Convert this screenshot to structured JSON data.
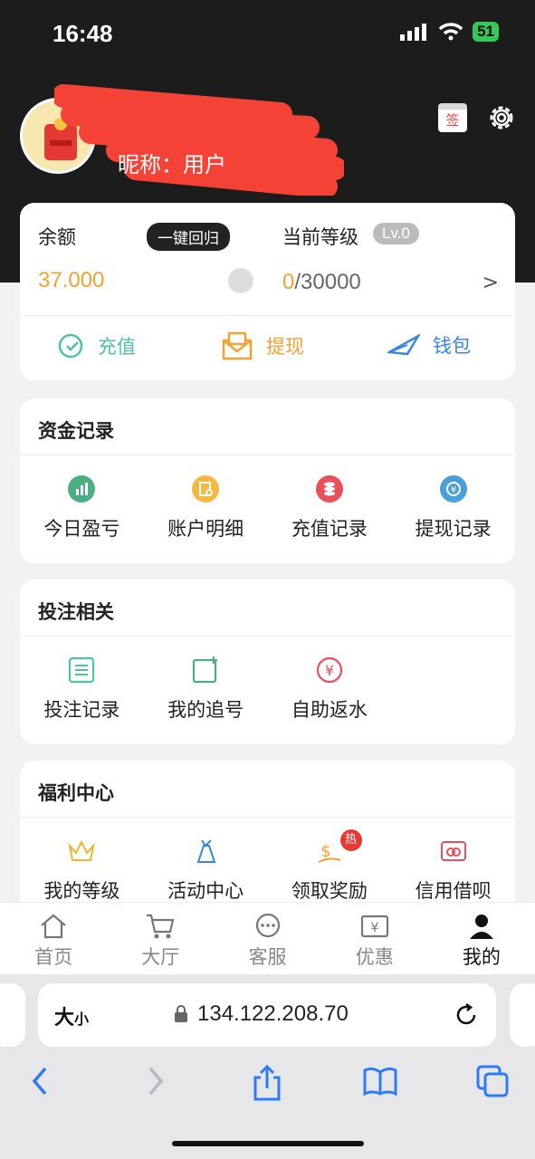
{
  "status_bar": {
    "time": "16:48",
    "battery": "51"
  },
  "profile": {
    "nickname": "昵称：用户"
  },
  "header_icons": {
    "sign_label": "签"
  },
  "balance": {
    "label": "余额",
    "return_button": "一键回归",
    "value": "37.000",
    "level_label": "当前等级",
    "level_badge": "Lv.0",
    "level_current": "0",
    "level_total": "/30000",
    "arrow": ">"
  },
  "actions": {
    "recharge": "充值",
    "withdraw": "提现",
    "wallet": "钱包"
  },
  "funds": {
    "title": "资金记录",
    "items": [
      "今日盈亏",
      "账户明细",
      "充值记录",
      "提现记录"
    ]
  },
  "bets": {
    "title": "投注相关",
    "items": [
      "投注记录",
      "我的追号",
      "自助返水"
    ]
  },
  "welfare": {
    "title": "福利中心",
    "items": [
      "我的等级",
      "活动中心",
      "领取奖励",
      "信用借呗"
    ],
    "hot_badge": "热"
  },
  "tabbar": [
    "首页",
    "大厅",
    "客服",
    "优惠",
    "我的"
  ],
  "browser": {
    "font_size_big": "大",
    "font_size_small": "小",
    "url": "134.122.208.70"
  },
  "colors": {
    "accent_orange": "#f4a033",
    "recharge_teal": "#4fc3a1",
    "wallet_blue": "#3a86e0",
    "header_bg": "#1c1c1c"
  }
}
